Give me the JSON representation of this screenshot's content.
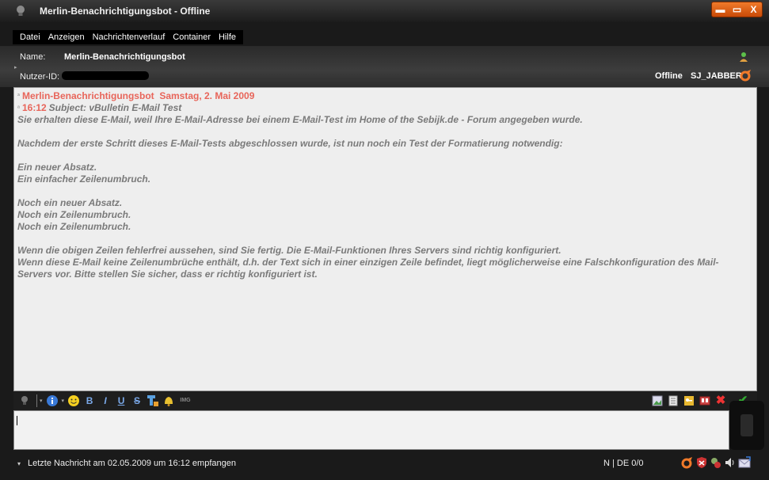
{
  "window": {
    "title": "Merlin-Benachrichtigungsbot - Offline",
    "buttons": {
      "minimize": "▬",
      "maximize": "▭",
      "close": "X"
    }
  },
  "menu": [
    "Datei",
    "Anzeigen",
    "Nachrichtenverlauf",
    "Container",
    "Hilfe"
  ],
  "contact": {
    "name_label": "Name:",
    "name_value": "Merlin-Benachrichtigungsbot",
    "userid_label": "Nutzer-ID:",
    "status": "Offline",
    "account": "SJ_JABBER"
  },
  "message": {
    "sender": "Merlin-Benachrichtigungsbot",
    "date": "Samstag, 2. Mai 2009",
    "time": "16:12",
    "subject": "Subject: vBulletin E-Mail Test",
    "body": [
      "Sie erhalten diese E-Mail, weil Ihre E-Mail-Adresse bei einem E-Mail-Test im Home of the Sebijk.de - Forum angegeben wurde.",
      "",
      "Nachdem der erste Schritt dieses E-Mail-Tests abgeschlossen wurde, ist nun noch ein Test der Formatierung notwendig:",
      "",
      "Ein neuer Absatz.",
      "Ein einfacher Zeilenumbruch.",
      "",
      "Noch ein neuer Absatz.",
      "Noch ein Zeilenumbruch.",
      "Noch ein Zeilenumbruch.",
      "",
      "Wenn die obigen Zeilen fehlerfrei aussehen, sind Sie fertig. Die E-Mail-Funktionen Ihres Servers sind richtig konfiguriert.",
      "Wenn diese E-Mail keine Zeilenumbrüche enthält, d.h. der Text sich in einer einzigen Zeile befindet, liegt möglicherweise eine Falschkonfiguration des Mail-Servers vor. Bitte stellen Sie sicher, dass er richtig konfiguriert ist."
    ]
  },
  "toolbar": {
    "bold": "B",
    "italic": "I",
    "underline": "U",
    "strike": "S",
    "img": "IMG"
  },
  "status_bar": {
    "last_message": "Letzte Nachricht am 02.05.2009 um 16:12 empfangen",
    "lang": "N | DE 0/0"
  },
  "colors": {
    "accent": "#e8655a",
    "orange": "#f07a2a",
    "body_text": "#7a7a7a"
  }
}
